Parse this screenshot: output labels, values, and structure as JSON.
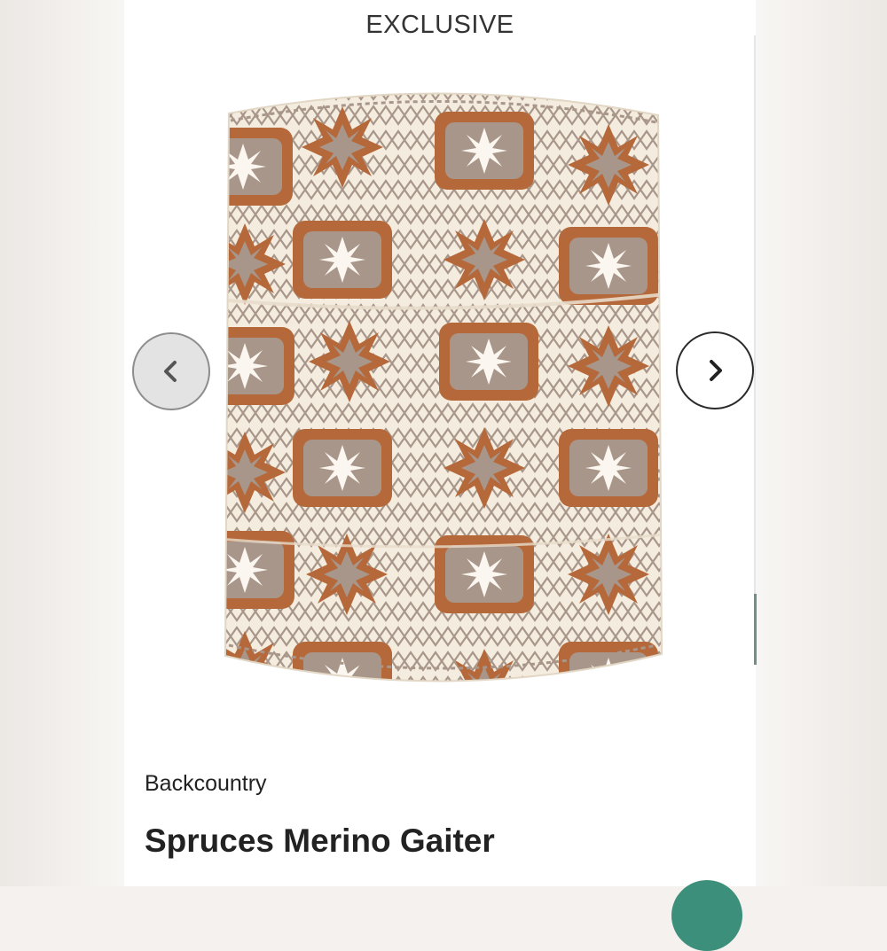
{
  "product": {
    "badge": "EXCLUSIVE",
    "brand": "Backcountry",
    "title": "Spruces Merino Gaiter",
    "image_alt": "patterned merino neck gaiter"
  },
  "carousel": {
    "prev_icon": "chevron-left-icon",
    "next_icon": "chevron-right-icon"
  },
  "colors": {
    "pattern_rust": "#b5683a",
    "pattern_taupe": "#a8968a",
    "pattern_cream": "#f4ecde",
    "accent_green": "#3c8f7a"
  }
}
